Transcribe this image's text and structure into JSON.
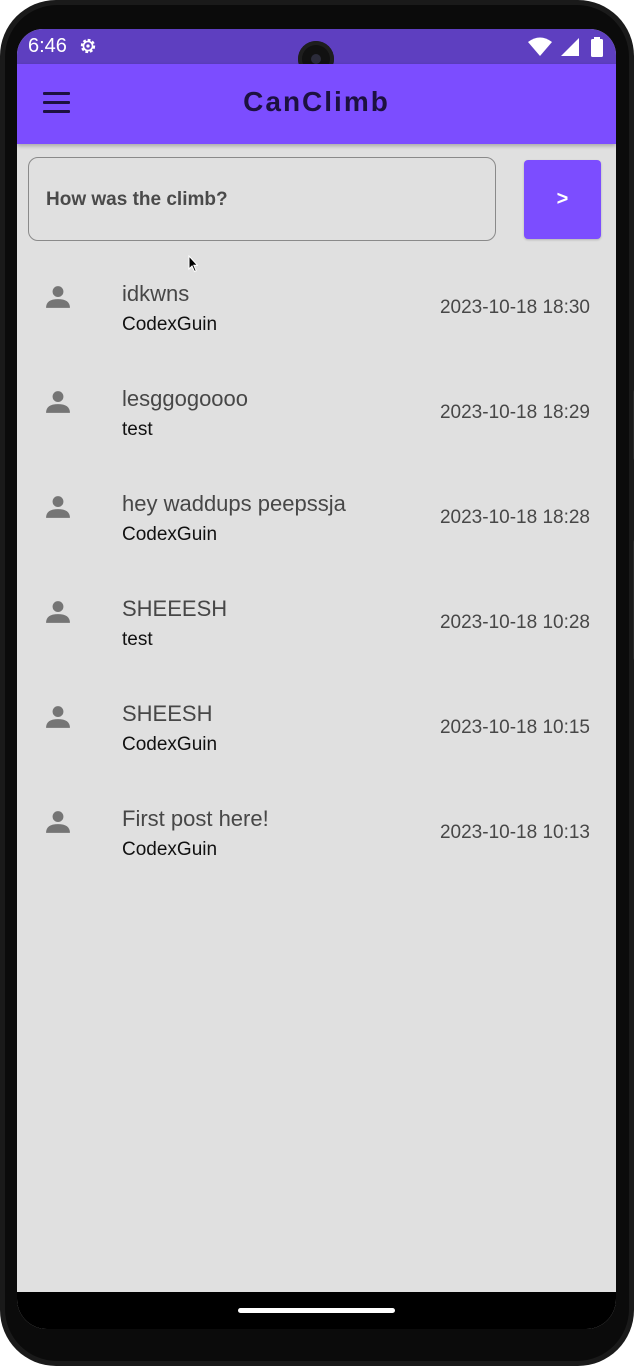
{
  "status_bar": {
    "time": "6:46",
    "icons": [
      "settings-gear-icon",
      "wifi-icon",
      "cell-signal-icon",
      "battery-icon"
    ]
  },
  "app_bar": {
    "title": "CanClimb",
    "menu_icon": "menu-icon",
    "color": "#7c4dff"
  },
  "compose": {
    "placeholder": "How was the climb?",
    "send_label": ">"
  },
  "posts": [
    {
      "text": "idkwns",
      "author": "CodexGuin",
      "timestamp": "2023-10-18 18:30",
      "icon": "person-icon"
    },
    {
      "text": "lesggogoooo",
      "author": "test",
      "timestamp": "2023-10-18 18:29",
      "icon": "person-icon"
    },
    {
      "text": "hey waddups peepssja",
      "author": "CodexGuin",
      "timestamp": "2023-10-18 18:28",
      "icon": "person-icon"
    },
    {
      "text": "SHEEESH",
      "author": "test",
      "timestamp": "2023-10-18 10:28",
      "icon": "person-icon"
    },
    {
      "text": "SHEESH",
      "author": "CodexGuin",
      "timestamp": "2023-10-18 10:15",
      "icon": "person-icon"
    },
    {
      "text": "First post here!",
      "author": "CodexGuin",
      "timestamp": "2023-10-18 10:13",
      "icon": "person-icon"
    }
  ],
  "colors": {
    "status_bar": "#5e3fc0",
    "accent": "#7c4dff",
    "background": "#e0e0e0"
  }
}
